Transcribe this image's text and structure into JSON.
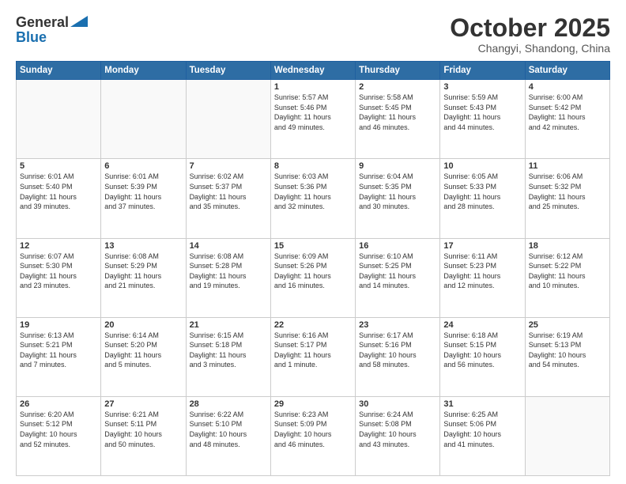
{
  "header": {
    "logo_general": "General",
    "logo_blue": "Blue",
    "month_title": "October 2025",
    "location": "Changyi, Shandong, China"
  },
  "weekdays": [
    "Sunday",
    "Monday",
    "Tuesday",
    "Wednesday",
    "Thursday",
    "Friday",
    "Saturday"
  ],
  "weeks": [
    [
      {
        "day": "",
        "info": ""
      },
      {
        "day": "",
        "info": ""
      },
      {
        "day": "",
        "info": ""
      },
      {
        "day": "1",
        "info": "Sunrise: 5:57 AM\nSunset: 5:46 PM\nDaylight: 11 hours\nand 49 minutes."
      },
      {
        "day": "2",
        "info": "Sunrise: 5:58 AM\nSunset: 5:45 PM\nDaylight: 11 hours\nand 46 minutes."
      },
      {
        "day": "3",
        "info": "Sunrise: 5:59 AM\nSunset: 5:43 PM\nDaylight: 11 hours\nand 44 minutes."
      },
      {
        "day": "4",
        "info": "Sunrise: 6:00 AM\nSunset: 5:42 PM\nDaylight: 11 hours\nand 42 minutes."
      }
    ],
    [
      {
        "day": "5",
        "info": "Sunrise: 6:01 AM\nSunset: 5:40 PM\nDaylight: 11 hours\nand 39 minutes."
      },
      {
        "day": "6",
        "info": "Sunrise: 6:01 AM\nSunset: 5:39 PM\nDaylight: 11 hours\nand 37 minutes."
      },
      {
        "day": "7",
        "info": "Sunrise: 6:02 AM\nSunset: 5:37 PM\nDaylight: 11 hours\nand 35 minutes."
      },
      {
        "day": "8",
        "info": "Sunrise: 6:03 AM\nSunset: 5:36 PM\nDaylight: 11 hours\nand 32 minutes."
      },
      {
        "day": "9",
        "info": "Sunrise: 6:04 AM\nSunset: 5:35 PM\nDaylight: 11 hours\nand 30 minutes."
      },
      {
        "day": "10",
        "info": "Sunrise: 6:05 AM\nSunset: 5:33 PM\nDaylight: 11 hours\nand 28 minutes."
      },
      {
        "day": "11",
        "info": "Sunrise: 6:06 AM\nSunset: 5:32 PM\nDaylight: 11 hours\nand 25 minutes."
      }
    ],
    [
      {
        "day": "12",
        "info": "Sunrise: 6:07 AM\nSunset: 5:30 PM\nDaylight: 11 hours\nand 23 minutes."
      },
      {
        "day": "13",
        "info": "Sunrise: 6:08 AM\nSunset: 5:29 PM\nDaylight: 11 hours\nand 21 minutes."
      },
      {
        "day": "14",
        "info": "Sunrise: 6:08 AM\nSunset: 5:28 PM\nDaylight: 11 hours\nand 19 minutes."
      },
      {
        "day": "15",
        "info": "Sunrise: 6:09 AM\nSunset: 5:26 PM\nDaylight: 11 hours\nand 16 minutes."
      },
      {
        "day": "16",
        "info": "Sunrise: 6:10 AM\nSunset: 5:25 PM\nDaylight: 11 hours\nand 14 minutes."
      },
      {
        "day": "17",
        "info": "Sunrise: 6:11 AM\nSunset: 5:23 PM\nDaylight: 11 hours\nand 12 minutes."
      },
      {
        "day": "18",
        "info": "Sunrise: 6:12 AM\nSunset: 5:22 PM\nDaylight: 11 hours\nand 10 minutes."
      }
    ],
    [
      {
        "day": "19",
        "info": "Sunrise: 6:13 AM\nSunset: 5:21 PM\nDaylight: 11 hours\nand 7 minutes."
      },
      {
        "day": "20",
        "info": "Sunrise: 6:14 AM\nSunset: 5:20 PM\nDaylight: 11 hours\nand 5 minutes."
      },
      {
        "day": "21",
        "info": "Sunrise: 6:15 AM\nSunset: 5:18 PM\nDaylight: 11 hours\nand 3 minutes."
      },
      {
        "day": "22",
        "info": "Sunrise: 6:16 AM\nSunset: 5:17 PM\nDaylight: 11 hours\nand 1 minute."
      },
      {
        "day": "23",
        "info": "Sunrise: 6:17 AM\nSunset: 5:16 PM\nDaylight: 10 hours\nand 58 minutes."
      },
      {
        "day": "24",
        "info": "Sunrise: 6:18 AM\nSunset: 5:15 PM\nDaylight: 10 hours\nand 56 minutes."
      },
      {
        "day": "25",
        "info": "Sunrise: 6:19 AM\nSunset: 5:13 PM\nDaylight: 10 hours\nand 54 minutes."
      }
    ],
    [
      {
        "day": "26",
        "info": "Sunrise: 6:20 AM\nSunset: 5:12 PM\nDaylight: 10 hours\nand 52 minutes."
      },
      {
        "day": "27",
        "info": "Sunrise: 6:21 AM\nSunset: 5:11 PM\nDaylight: 10 hours\nand 50 minutes."
      },
      {
        "day": "28",
        "info": "Sunrise: 6:22 AM\nSunset: 5:10 PM\nDaylight: 10 hours\nand 48 minutes."
      },
      {
        "day": "29",
        "info": "Sunrise: 6:23 AM\nSunset: 5:09 PM\nDaylight: 10 hours\nand 46 minutes."
      },
      {
        "day": "30",
        "info": "Sunrise: 6:24 AM\nSunset: 5:08 PM\nDaylight: 10 hours\nand 43 minutes."
      },
      {
        "day": "31",
        "info": "Sunrise: 6:25 AM\nSunset: 5:06 PM\nDaylight: 10 hours\nand 41 minutes."
      },
      {
        "day": "",
        "info": ""
      }
    ]
  ]
}
